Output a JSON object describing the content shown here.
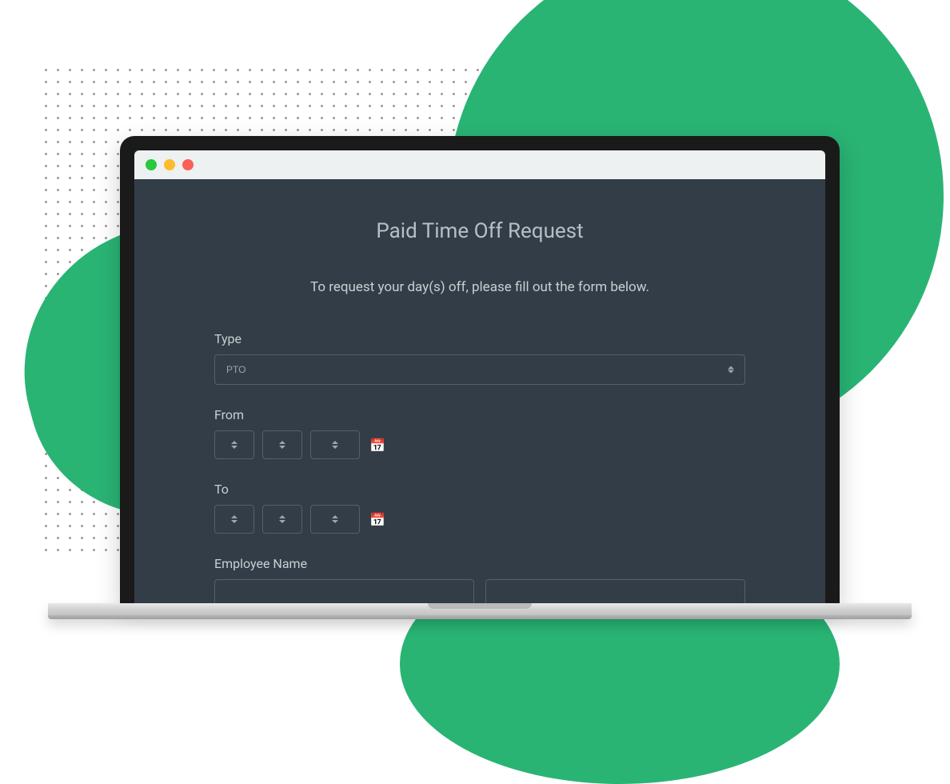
{
  "form": {
    "title": "Paid Time Off Request",
    "subtitle": "To request your day(s) off, please fill out the form below.",
    "fields": {
      "type": {
        "label": "Type",
        "selected": "PTO"
      },
      "from": {
        "label": "From"
      },
      "to": {
        "label": "To"
      },
      "employee_name": {
        "label": "Employee Name"
      }
    }
  }
}
